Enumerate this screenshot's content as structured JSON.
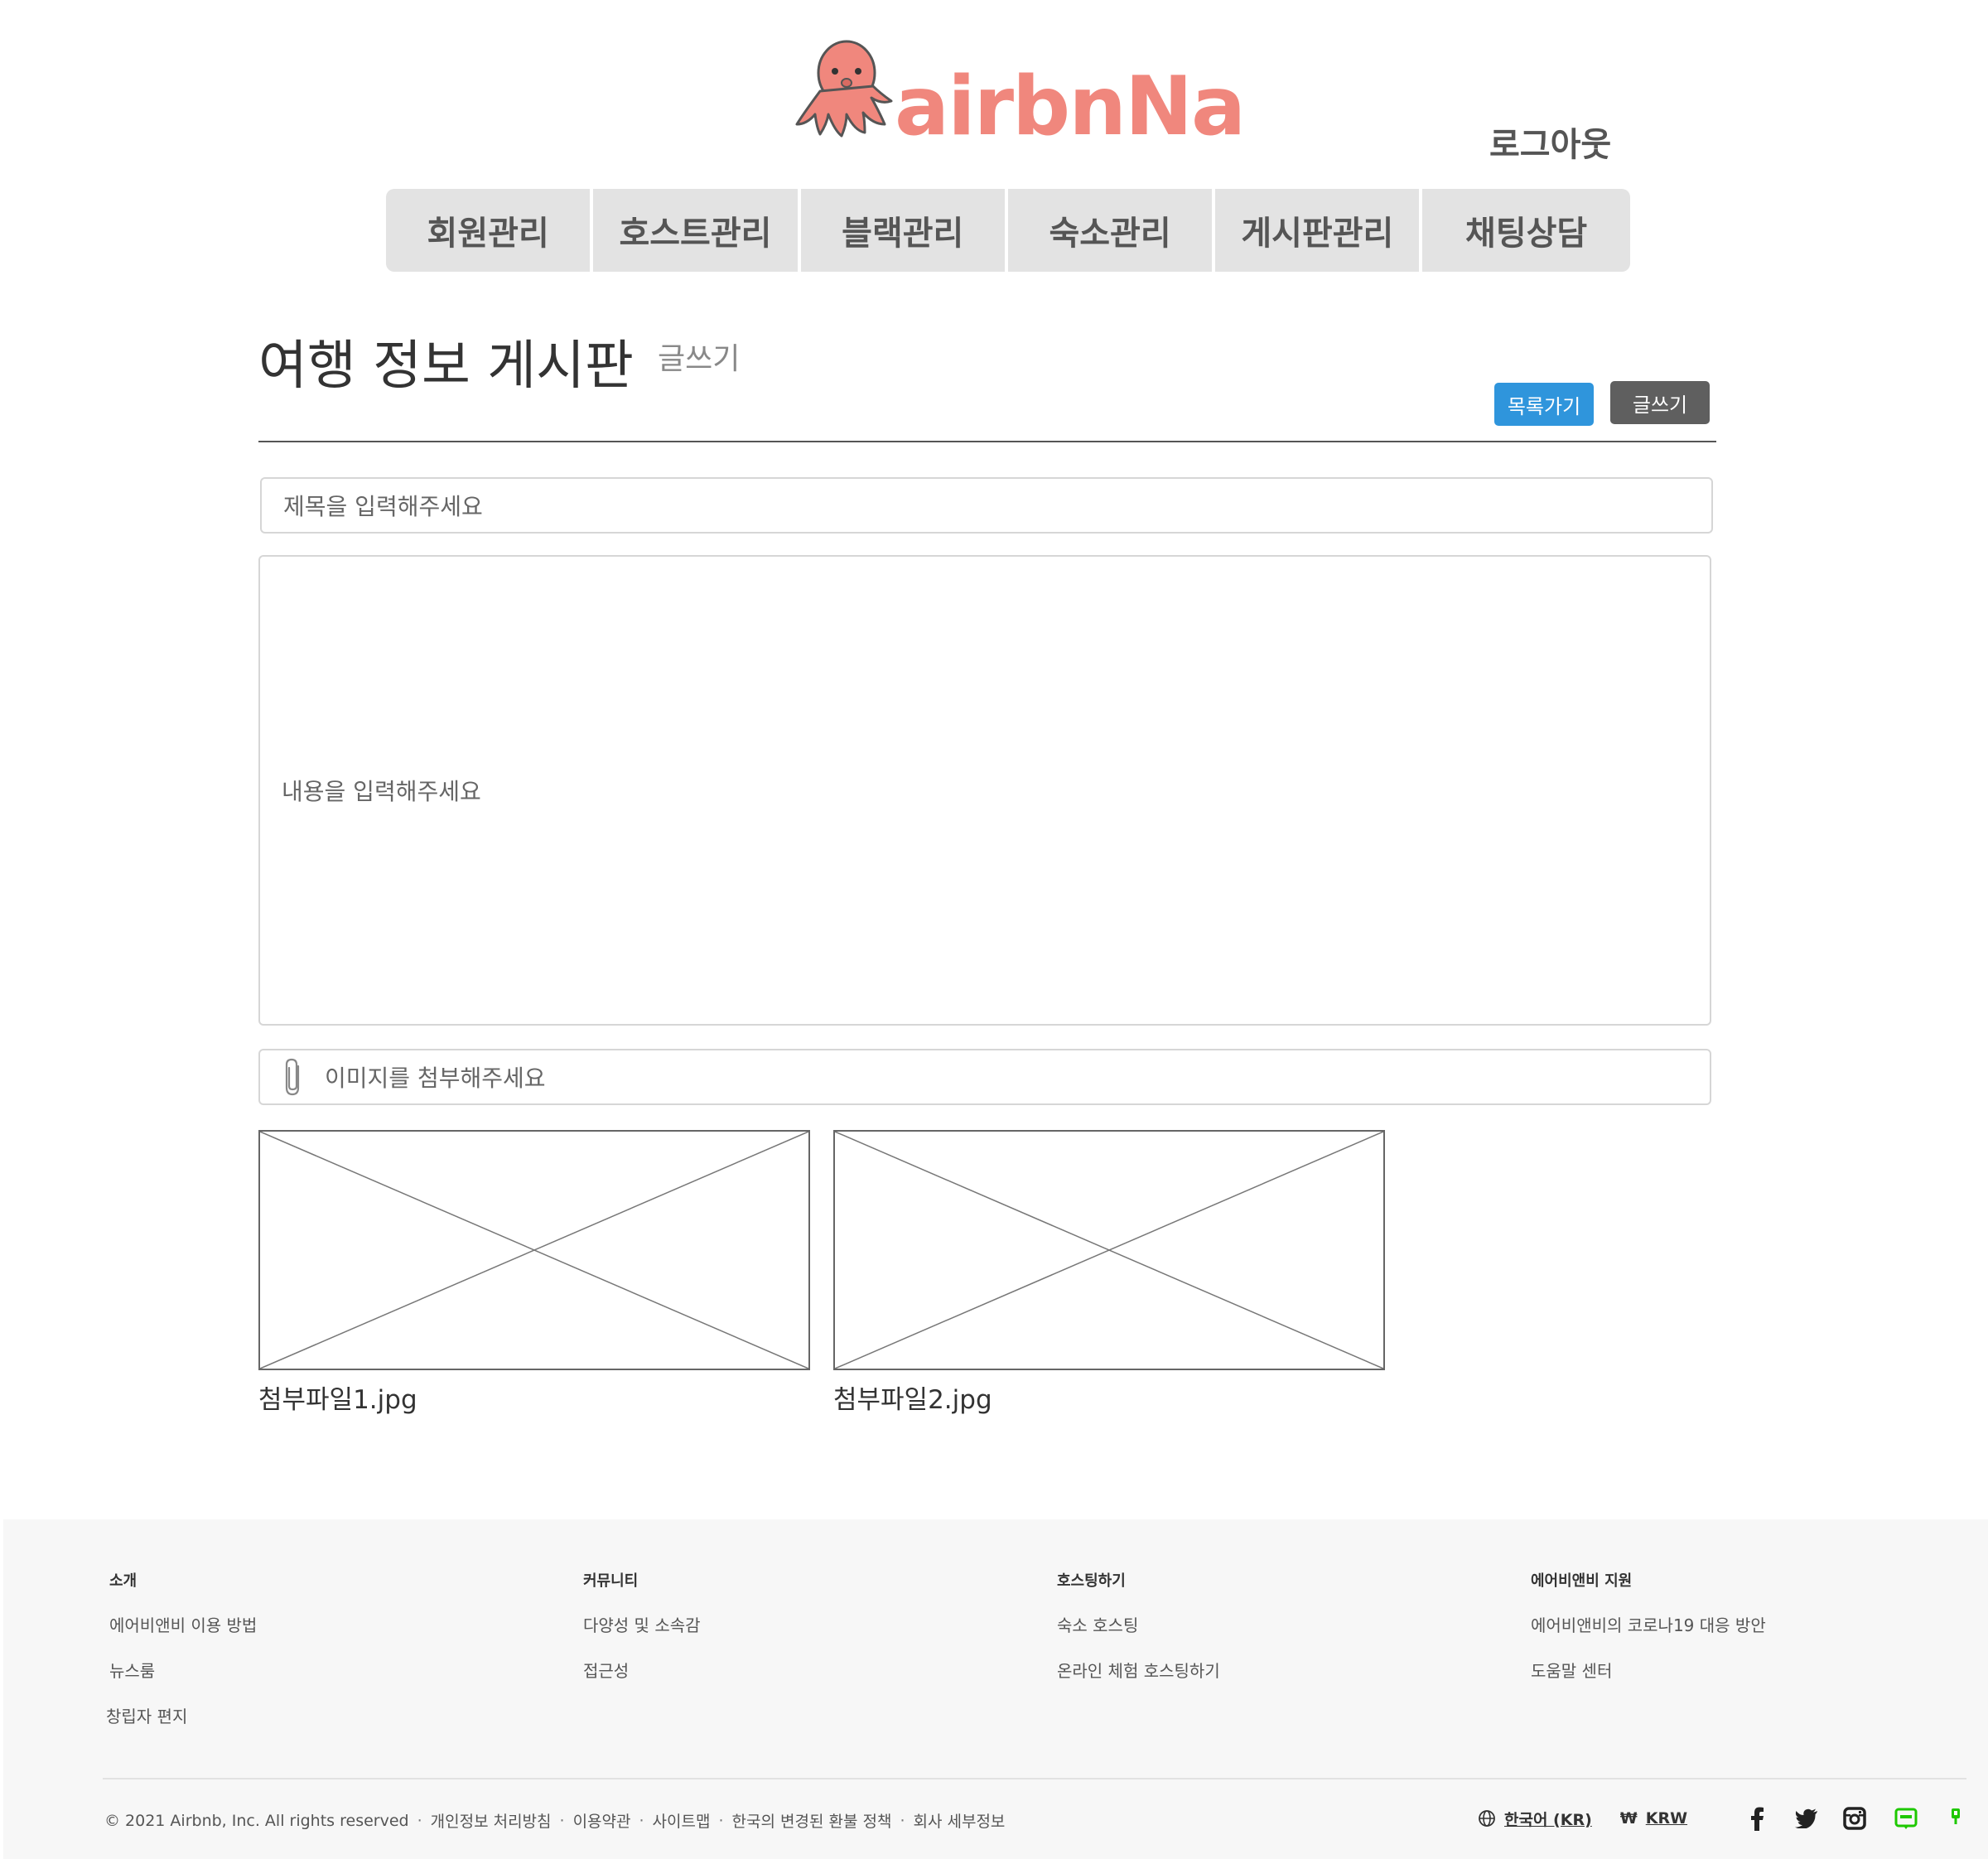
{
  "header": {
    "logo_text": "airbnNa",
    "logout_label": "로그아웃"
  },
  "nav": {
    "items": [
      {
        "label": "회원관리"
      },
      {
        "label": "호스트관리"
      },
      {
        "label": "블랙관리"
      },
      {
        "label": "숙소관리"
      },
      {
        "label": "게시판관리"
      },
      {
        "label": "채팅상담"
      }
    ]
  },
  "board": {
    "title": "여행 정보 게시판",
    "subtitle": "글쓰기",
    "list_button": "목록가기",
    "write_button": "글쓰기"
  },
  "form": {
    "title_placeholder": "제목을 입력해주세요",
    "content_placeholder": "내용을 입력해주세요",
    "attach_placeholder": "이미지를 첨부해주세요"
  },
  "attachments": [
    {
      "name": "첨부파일1.jpg"
    },
    {
      "name": "첨부파일2.jpg"
    }
  ],
  "footer": {
    "columns": [
      {
        "heading": "소개",
        "links": [
          "에어비앤비 이용 방법",
          "뉴스룸",
          "창립자 편지"
        ]
      },
      {
        "heading": "커뮤니티",
        "links": [
          "다양성 및 소속감",
          "접근성"
        ]
      },
      {
        "heading": "호스팅하기",
        "links": [
          "숙소 호스팅",
          "온라인 체험 호스팅하기"
        ]
      },
      {
        "heading": "에어비앤비 지원",
        "links": [
          "에어비앤비의 코로나19 대응 방안",
          "도움말 센터"
        ]
      }
    ],
    "copyright": "© 2021 Airbnb, Inc. All rights reserved",
    "bottom_links": [
      "개인정보 처리방침",
      "이용약관",
      "사이트맵",
      "한국의 변경된 환불 정책",
      "회사 세부정보"
    ],
    "language": "한국어 (KR)",
    "currency_symbol": "₩",
    "currency": "KRW",
    "social_icons": [
      "facebook-icon",
      "twitter-icon",
      "instagram-icon",
      "naver-blog-icon",
      "naver-post-icon"
    ]
  },
  "colors": {
    "brand": "#f0877d",
    "primary_button": "#2f95dc",
    "dark_button": "#5f5f5f",
    "nav_background": "#e3e3e3",
    "footer_background": "#f7f7f7"
  }
}
